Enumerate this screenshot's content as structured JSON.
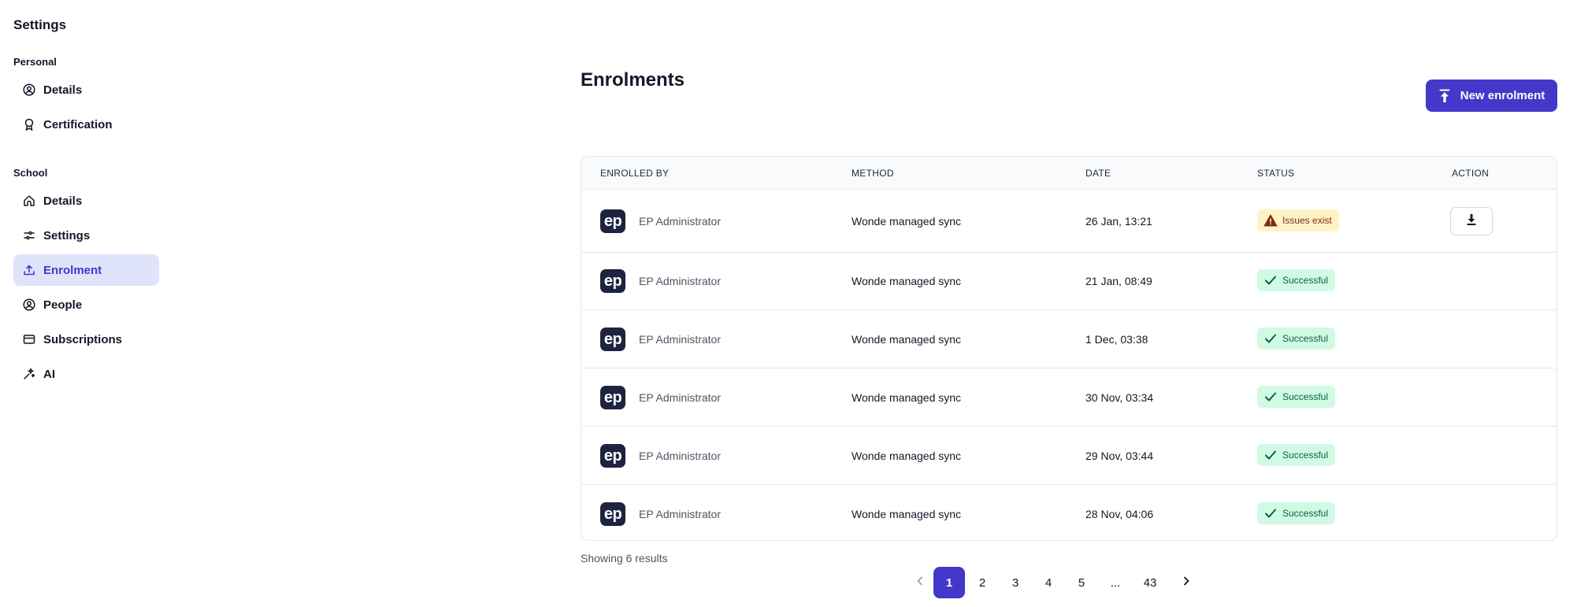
{
  "sidebar": {
    "title": "Settings",
    "sections": [
      {
        "label": "Personal",
        "items": [
          {
            "label": "Details",
            "icon": "user-circle-icon"
          },
          {
            "label": "Certification",
            "icon": "award-icon"
          }
        ]
      },
      {
        "label": "School",
        "items": [
          {
            "label": "Details",
            "icon": "home-icon"
          },
          {
            "label": "Settings",
            "icon": "sliders-icon"
          },
          {
            "label": "Enrolment",
            "icon": "upload-icon",
            "active": true
          },
          {
            "label": "People",
            "icon": "user-circle-icon"
          },
          {
            "label": "Subscriptions",
            "icon": "credit-card-icon"
          },
          {
            "label": "AI",
            "icon": "sparkle-wand-icon"
          }
        ]
      }
    ]
  },
  "main": {
    "title": "Enrolments",
    "new_button_label": "New enrolment",
    "table": {
      "headers": [
        "ENROLLED BY",
        "METHOD",
        "DATE",
        "STATUS",
        "ACTION"
      ],
      "rows": [
        {
          "avatar": "ep",
          "enrolled_by": "EP Administrator",
          "method": "Wonde managed sync",
          "date": "26 Jan, 13:21",
          "status": "Issues exist",
          "status_type": "warning",
          "action": "download-icon"
        },
        {
          "avatar": "ep",
          "enrolled_by": "EP Administrator",
          "method": "Wonde managed sync",
          "date": "21 Jan, 08:49",
          "status": "Successful",
          "status_type": "success"
        },
        {
          "avatar": "ep",
          "enrolled_by": "EP Administrator",
          "method": "Wonde managed sync",
          "date": "1 Dec, 03:38",
          "status": "Successful",
          "status_type": "success"
        },
        {
          "avatar": "ep",
          "enrolled_by": "EP Administrator",
          "method": "Wonde managed sync",
          "date": "30 Nov, 03:34",
          "status": "Successful",
          "status_type": "success"
        },
        {
          "avatar": "ep",
          "enrolled_by": "EP Administrator",
          "method": "Wonde managed sync",
          "date": "29 Nov, 03:44",
          "status": "Successful",
          "status_type": "success"
        },
        {
          "avatar": "ep",
          "enrolled_by": "EP Administrator",
          "method": "Wonde managed sync",
          "date": "28 Nov, 04:06",
          "status": "Successful",
          "status_type": "success"
        }
      ]
    },
    "results_text": "Showing 6 results",
    "pagination": {
      "pages": [
        "1",
        "2",
        "3",
        "4",
        "5",
        "...",
        "43"
      ],
      "current": "1"
    }
  },
  "colors": {
    "accent": "#4338ca",
    "active_nav_bg": "#dfe4fb",
    "success_bg": "#d1fae5",
    "warning_bg": "#fef3c7",
    "avatar_bg": "#1e2340"
  }
}
